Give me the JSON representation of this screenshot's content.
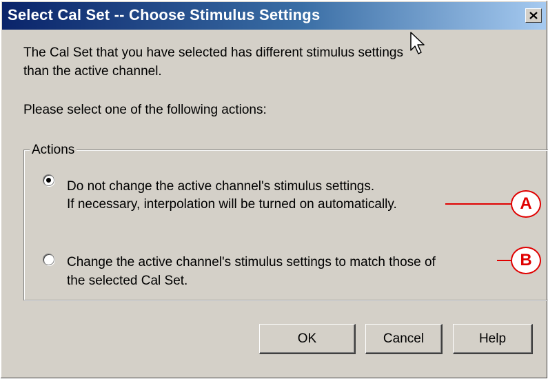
{
  "dialog": {
    "title": "Select Cal Set -- Choose Stimulus Settings",
    "close_glyph": "×",
    "message_line1": "The Cal Set that you have selected has different stimulus settings",
    "message_line2": "than the active channel.",
    "prompt": "Please select one of the following actions:"
  },
  "actions_group": {
    "label": "Actions",
    "options": [
      {
        "line1": "Do not change the active channel's stimulus settings.",
        "line2": "If necessary, interpolation will be turned on automatically.",
        "selected": true,
        "callout": "A"
      },
      {
        "line1": "Change the active channel's stimulus settings to match those of",
        "line2": "the selected Cal Set.",
        "selected": false,
        "callout": "B"
      }
    ]
  },
  "buttons": {
    "ok": "OK",
    "cancel": "Cancel",
    "help": "Help"
  },
  "colors": {
    "title_gradient_start": "#0a246a",
    "title_gradient_end": "#a6caf0",
    "window_bg": "#d4d0c8",
    "callout": "#e00000"
  },
  "icons": {
    "close": "close-icon",
    "cursor": "mouse-pointer-icon",
    "radio_selected": "radio-selected-icon",
    "radio_unselected": "radio-unselected-icon"
  }
}
